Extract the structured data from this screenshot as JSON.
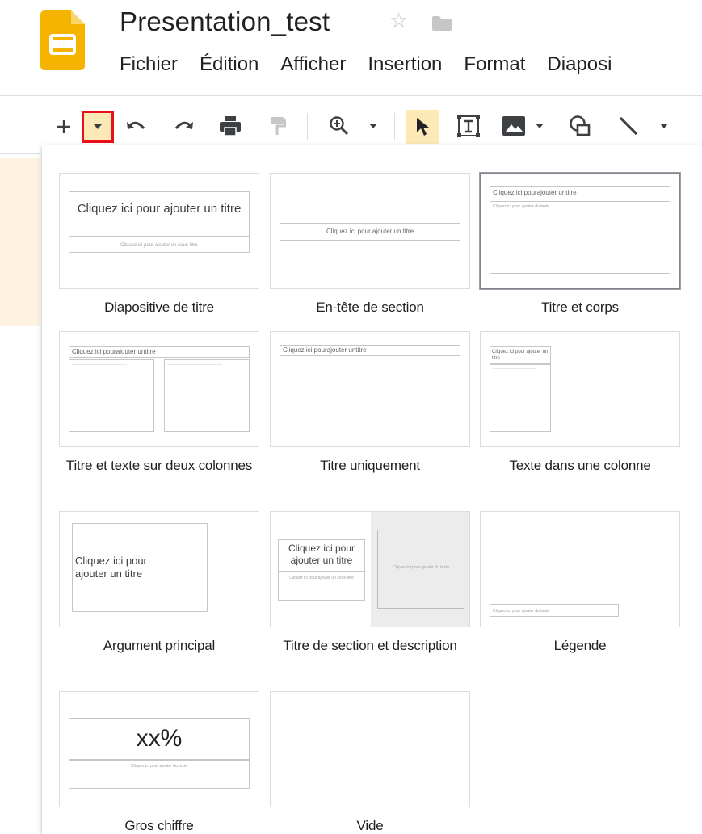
{
  "header": {
    "doc_title": "Presentation_test",
    "menu": [
      "Fichier",
      "Édition",
      "Afficher",
      "Insertion",
      "Format",
      "Diaposi"
    ]
  },
  "colors": {
    "slides_yellow": "#f4b400",
    "highlight_bg": "#fde9b5",
    "highlight_border": "#e8101a"
  },
  "toolbar": {
    "icons": [
      "plus-icon",
      "dropdown-caret-icon",
      "undo-icon",
      "redo-icon",
      "print-icon",
      "paint-format-icon",
      "zoom-icon",
      "select-cursor-icon",
      "text-box-icon",
      "image-icon",
      "shape-icon",
      "line-icon"
    ]
  },
  "layouts": {
    "labels": [
      "Diapositive de titre",
      "En-tête de section",
      "Titre et corps",
      "Titre et texte sur deux colonnes",
      "Titre uniquement",
      "Texte dans une colonne",
      "Argument principal",
      "Titre de section et description",
      "Légende",
      "Gros chiffre",
      "Vide"
    ],
    "thumb_text": {
      "title_big": "Cliquez ici pour ajouter un titre",
      "subtitle_small": "Cliquez ici pour ajouter un sous-titre",
      "title_small": "Cliquez ici pour ajouter un titre",
      "title_compact": "Cliquez ici pourajouter untitre",
      "body_tiny": "Cliquez ici pour ajouter du texte",
      "col_title": "Cliquez ici pour ajouter un titre",
      "main_point": "Cliquez ici pour ajouter un titre",
      "section_title": "Cliquez ici pour ajouter un titre",
      "section_sub": "Cliquez ici pour ajouter un sous-titre",
      "section_body": "Cliquez ici pour ajouter du texte",
      "caption": "Cliquez ici pour ajouter du texte",
      "big_number": "xx%",
      "big_number_sub": "Cliquez ici pour ajouter du texte"
    }
  }
}
